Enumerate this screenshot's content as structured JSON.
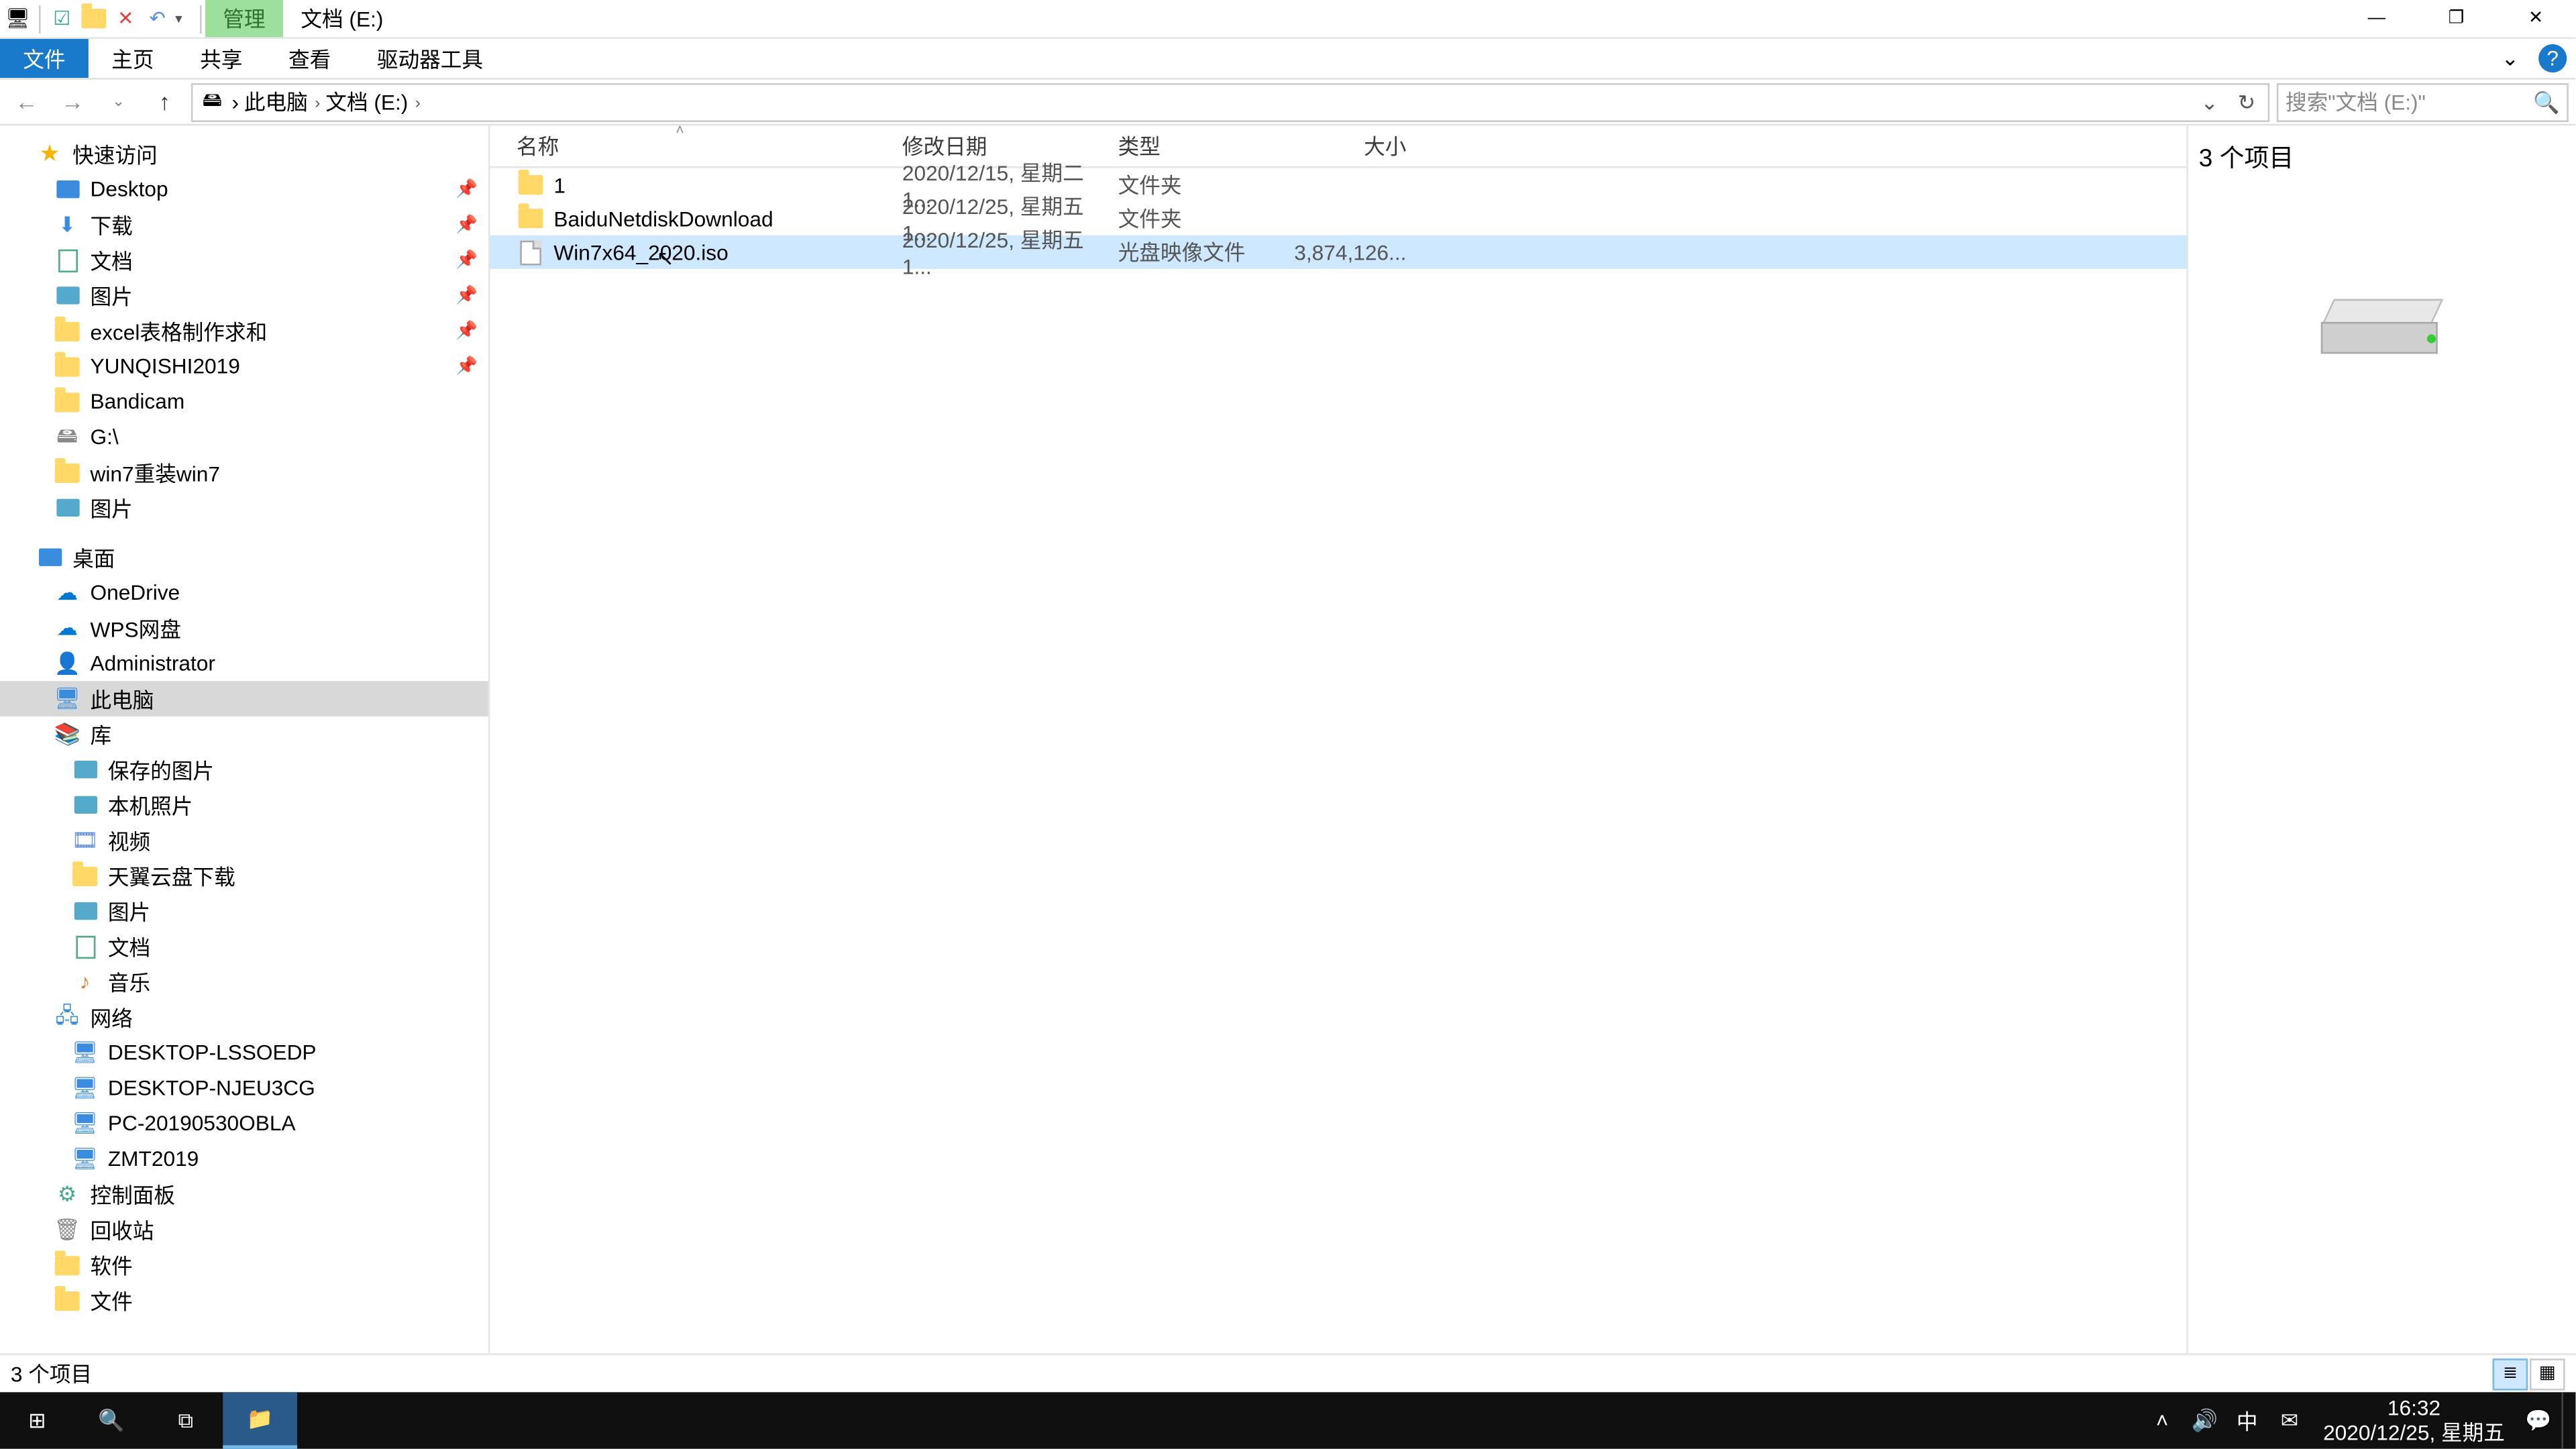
{
  "titlebar": {
    "manage_tab": "管理",
    "path_tab": "文档 (E:)"
  },
  "winctrl": {
    "min": "—",
    "max": "❐",
    "close": "✕"
  },
  "ribbon": {
    "file": "文件",
    "home": "主页",
    "share": "共享",
    "view": "查看",
    "drive": "驱动器工具",
    "expand": "⌄",
    "help": "?"
  },
  "nav": {
    "back": "←",
    "fwd": "→",
    "recent": "⌄",
    "up": "↑",
    "crumbs": [
      "此电脑",
      "文档 (E:)"
    ],
    "crumb_arrow": "›",
    "dropdown": "⌄",
    "refresh": "↻",
    "search_placeholder": "搜索\"文档 (E:)\"",
    "search_icon": "🔍"
  },
  "tree": [
    {
      "icon": "star",
      "label": "快速访问",
      "depth": 1
    },
    {
      "icon": "desk",
      "label": "Desktop",
      "depth": 2,
      "pin": true
    },
    {
      "icon": "dl",
      "label": "下载",
      "depth": 2,
      "pin": true
    },
    {
      "icon": "doc",
      "label": "文档",
      "depth": 2,
      "pin": true
    },
    {
      "icon": "img",
      "label": "图片",
      "depth": 2,
      "pin": true
    },
    {
      "icon": "folder",
      "label": "excel表格制作求和",
      "depth": 2,
      "pin": true
    },
    {
      "icon": "folder",
      "label": "YUNQISHI2019",
      "depth": 2,
      "pin": true
    },
    {
      "icon": "folder",
      "label": "Bandicam",
      "depth": 2
    },
    {
      "icon": "drv",
      "label": "G:\\",
      "depth": 2
    },
    {
      "icon": "folder",
      "label": "win7重装win7",
      "depth": 2
    },
    {
      "icon": "img",
      "label": "图片",
      "depth": 2
    },
    {
      "spacer": true
    },
    {
      "icon": "desk",
      "label": "桌面",
      "depth": 1
    },
    {
      "icon": "od",
      "label": "OneDrive",
      "depth": 2
    },
    {
      "icon": "wps",
      "label": "WPS网盘",
      "depth": 2
    },
    {
      "icon": "user",
      "label": "Administrator",
      "depth": 2
    },
    {
      "icon": "pc",
      "label": "此电脑",
      "depth": 2,
      "sel": true
    },
    {
      "icon": "lib",
      "label": "库",
      "depth": 2
    },
    {
      "icon": "img",
      "label": "保存的图片",
      "depth": 3
    },
    {
      "icon": "img",
      "label": "本机照片",
      "depth": 3
    },
    {
      "icon": "vid",
      "label": "视频",
      "depth": 3
    },
    {
      "icon": "folder",
      "label": "天翼云盘下载",
      "depth": 3
    },
    {
      "icon": "img",
      "label": "图片",
      "depth": 3
    },
    {
      "icon": "doc",
      "label": "文档",
      "depth": 3
    },
    {
      "icon": "mus",
      "label": "音乐",
      "depth": 3
    },
    {
      "icon": "net",
      "label": "网络",
      "depth": 2
    },
    {
      "icon": "pc",
      "label": "DESKTOP-LSSOEDP",
      "depth": 3
    },
    {
      "icon": "pc",
      "label": "DESKTOP-NJEU3CG",
      "depth": 3
    },
    {
      "icon": "pc",
      "label": "PC-20190530OBLA",
      "depth": 3
    },
    {
      "icon": "pc",
      "label": "ZMT2019",
      "depth": 3
    },
    {
      "icon": "cp",
      "label": "控制面板",
      "depth": 2
    },
    {
      "icon": "rec",
      "label": "回收站",
      "depth": 2
    },
    {
      "icon": "folder",
      "label": "软件",
      "depth": 2
    },
    {
      "icon": "folder",
      "label": "文件",
      "depth": 2
    }
  ],
  "columns": {
    "name": "名称",
    "date": "修改日期",
    "type": "类型",
    "size": "大小"
  },
  "rows": [
    {
      "icon": "folder",
      "name": "1",
      "date": "2020/12/15, 星期二 1...",
      "type": "文件夹",
      "size": ""
    },
    {
      "icon": "folder",
      "name": "BaiduNetdiskDownload",
      "date": "2020/12/25, 星期五 1...",
      "type": "文件夹",
      "size": ""
    },
    {
      "icon": "file",
      "name": "Win7x64_2020.iso",
      "date": "2020/12/25, 星期五 1...",
      "type": "光盘映像文件",
      "size": "3,874,126...",
      "sel": true
    }
  ],
  "preview": {
    "title": "3 个项目"
  },
  "status": {
    "text": "3 个项目"
  },
  "taskbar": {
    "start": "⊞",
    "search": "🔍",
    "taskview": "⧉",
    "explorer": "📁",
    "tray_up": "˄",
    "vol": "🔊",
    "ime": "中",
    "mail": "✉",
    "action": "💬",
    "time": "16:32",
    "date": "2020/12/25, 星期五"
  }
}
